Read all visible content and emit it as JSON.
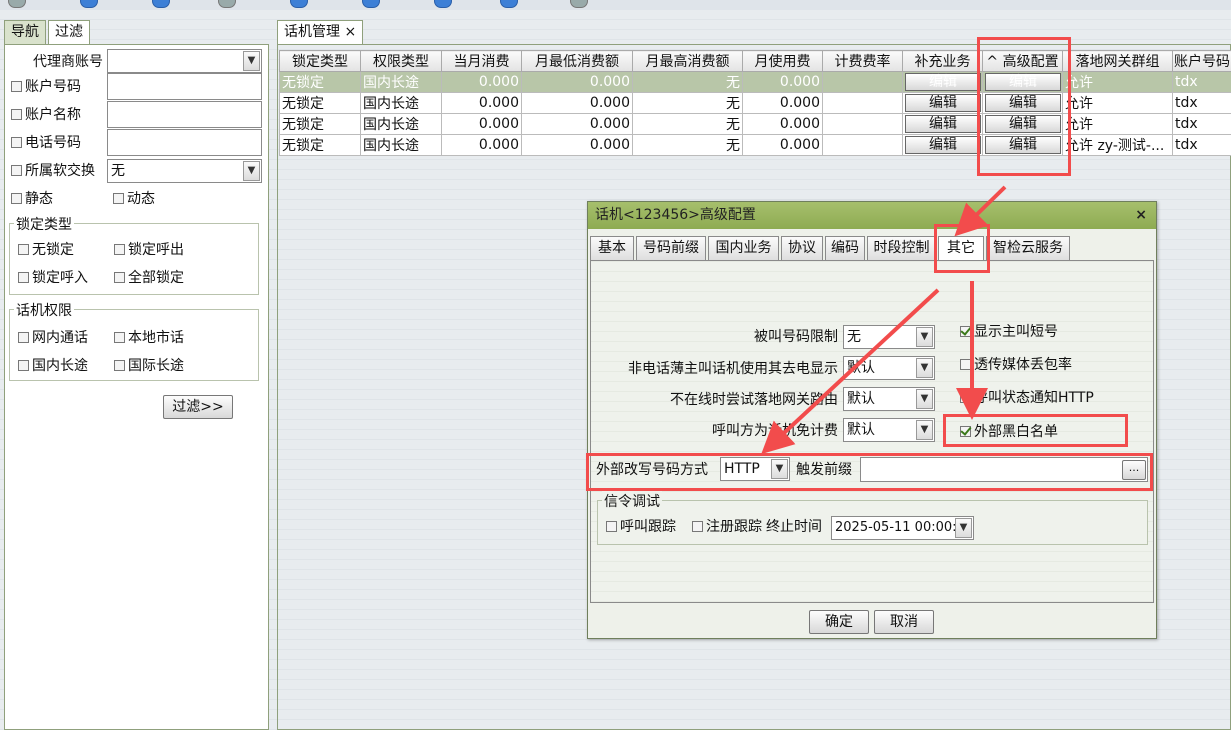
{
  "left": {
    "tabs": [
      "导航",
      "过滤"
    ],
    "filters": {
      "agent_account": {
        "label": "代理商账号",
        "value": ""
      },
      "account_no": {
        "label": "账户号码"
      },
      "account_name": {
        "label": "账户名称"
      },
      "phone_no": {
        "label": "电话号码"
      },
      "softswitch": {
        "label": "所属软交换",
        "value": "无"
      },
      "static": "静态",
      "dynamic": "动态"
    },
    "lock_group": {
      "title": "锁定类型",
      "items": [
        "无锁定",
        "锁定呼出",
        "锁定呼入",
        "全部锁定"
      ]
    },
    "perm_group": {
      "title": "话机权限",
      "items": [
        "网内通话",
        "本地市话",
        "国内长途",
        "国际长途"
      ]
    },
    "filter_button": "过滤>>"
  },
  "main": {
    "tab_label": "话机管理",
    "tab_close": "×",
    "columns": [
      "锁定类型",
      "权限类型",
      "当月消费",
      "月最低消费额",
      "月最高消费额",
      "月使用费",
      "计费费率",
      "补充业务",
      "高级配置",
      "落地网关群组",
      "账户号码"
    ],
    "sort_indicator": "^",
    "rows": [
      [
        "无锁定",
        "国内长途",
        "0.000",
        "0.000",
        "无",
        "0.000",
        "",
        "编辑",
        "编辑",
        "允许",
        "tdx"
      ],
      [
        "无锁定",
        "国内长途",
        "0.000",
        "0.000",
        "无",
        "0.000",
        "",
        "编辑",
        "编辑",
        "允许",
        "tdx"
      ],
      [
        "无锁定",
        "国内长途",
        "0.000",
        "0.000",
        "无",
        "0.000",
        "",
        "编辑",
        "编辑",
        "允许",
        "tdx"
      ],
      [
        "无锁定",
        "国内长途",
        "0.000",
        "0.000",
        "无",
        "0.000",
        "",
        "编辑",
        "编辑",
        "允许 zy-测试-...",
        "tdx"
      ]
    ]
  },
  "dialog": {
    "title": "话机<123456>高级配置",
    "close": "×",
    "tabs": [
      "基本",
      "号码前缀",
      "国内业务",
      "协议",
      "编码",
      "时段控制",
      "其它",
      "智检云服务"
    ],
    "active_tab": "其它",
    "fields": [
      {
        "label": "被叫号码限制",
        "value": "无"
      },
      {
        "label": "非电话薄主叫话机使用其去电显示",
        "value": "默认"
      },
      {
        "label": "不在线时尝试落地网关路由",
        "value": "默认"
      },
      {
        "label": "呼叫方为话机免计费",
        "value": "默认"
      }
    ],
    "checks": [
      {
        "label": "显示主叫短号",
        "checked": true
      },
      {
        "label": "透传媒体丢包率",
        "checked": false
      },
      {
        "label": "呼叫状态通知HTTP",
        "checked": false
      },
      {
        "label": "外部黑白名单",
        "checked": true
      }
    ],
    "rewrite_label": "外部改写号码方式",
    "rewrite_value": "HTTP",
    "trigger_label": "触发前缀",
    "trigger_value": "",
    "ellipsis": "...",
    "signal_group": "信令调试",
    "call_trace": "呼叫跟踪",
    "reg_trace": "注册跟踪",
    "end_time_label": "终止时间",
    "end_time_value": "2025-05-11 00:00:0",
    "ok": "确定",
    "cancel": "取消"
  },
  "colors": {
    "highlight": "#f24c4c",
    "row_selected": "#b8c6a8",
    "title_bar": "#8eab52"
  }
}
